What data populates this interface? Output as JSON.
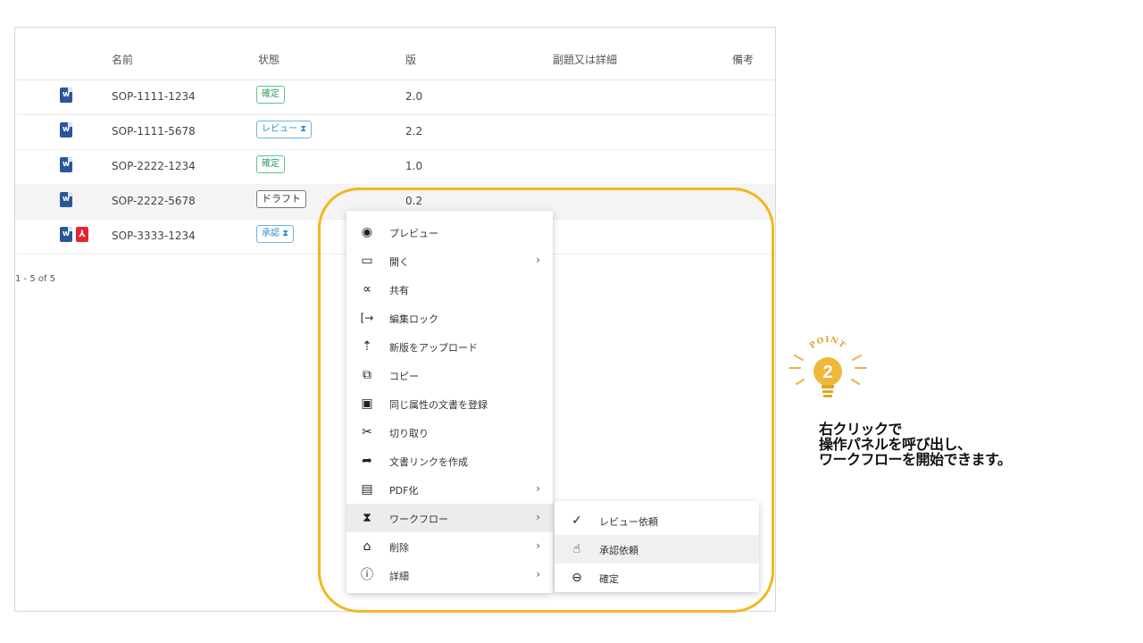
{
  "table": {
    "headers": [
      "名前",
      "状態",
      "版",
      "副題又は詳細",
      "備考"
    ],
    "rows": [
      {
        "name": "SOP-1111-1234",
        "status": "確定",
        "version": "2.0"
      },
      {
        "name": "SOP-1111-5678",
        "status": "レビュー ⧗",
        "version": "2.2"
      },
      {
        "name": "SOP-2222-1234",
        "status": "確定",
        "version": "1.0"
      },
      {
        "name": "SOP-2222-5678",
        "status": "ドラフト",
        "version": "0.2"
      },
      {
        "name": "SOP-3333-1234",
        "status": "承認 ⧗",
        "version": ""
      }
    ],
    "pagination": "1 - 5 of 5",
    "file_icon_letter": "w",
    "pdf_icon_letter": "⅄"
  },
  "context_menu": {
    "items": [
      {
        "icon": "eye-icon",
        "glyph": "◉",
        "label": "プレビュー"
      },
      {
        "icon": "laptop-icon",
        "glyph": "▭",
        "label": "開く",
        "arrow": "›"
      },
      {
        "icon": "share-icon",
        "glyph": "∝",
        "label": "共有"
      },
      {
        "icon": "lock-edit-icon",
        "glyph": "[→",
        "label": "編集ロック"
      },
      {
        "icon": "upload-icon",
        "glyph": "⇡",
        "label": "新版をアップロード"
      },
      {
        "icon": "copy-icon",
        "glyph": "⧉",
        "label": "コピー"
      },
      {
        "icon": "new-document-icon",
        "glyph": "▣",
        "label": "同じ属性の文書を登録"
      },
      {
        "icon": "scissors-icon",
        "glyph": "✂",
        "label": "切り取り"
      },
      {
        "icon": "link-arrow-icon",
        "glyph": "➦",
        "label": "文書リンクを作成"
      },
      {
        "icon": "pdf-icon",
        "glyph": "▤",
        "label": "PDF化",
        "arrow": "›"
      },
      {
        "icon": "hourglass-icon",
        "glyph": "⧗",
        "label": "ワークフロー",
        "arrow": "›"
      },
      {
        "icon": "trash-icon",
        "glyph": "⌂",
        "label": "削除",
        "arrow": "›"
      },
      {
        "icon": "info-icon",
        "glyph": "ⓘ",
        "label": "詳細",
        "arrow": "›"
      }
    ]
  },
  "workflow_submenu": {
    "items": [
      {
        "icon": "check-icon",
        "glyph": "✓",
        "label": "レビュー依頼"
      },
      {
        "icon": "thumbs-up-icon",
        "glyph": "☝",
        "label": "承認依頼"
      },
      {
        "icon": "lock-icon",
        "glyph": "⊖",
        "label": "確定"
      }
    ]
  },
  "callout": {
    "point_label": "POINT",
    "point_number": "2",
    "lines": [
      "右クリックで",
      "操作パネルを呼び出し、",
      "ワークフローを開始できます。"
    ]
  },
  "colors": {
    "highlight_border": "#f3b61f",
    "word_blue": "#2b579a",
    "pdf_red": "#e3262f",
    "status_green": "#2e9c5d",
    "status_blue": "#2d8fcf"
  }
}
